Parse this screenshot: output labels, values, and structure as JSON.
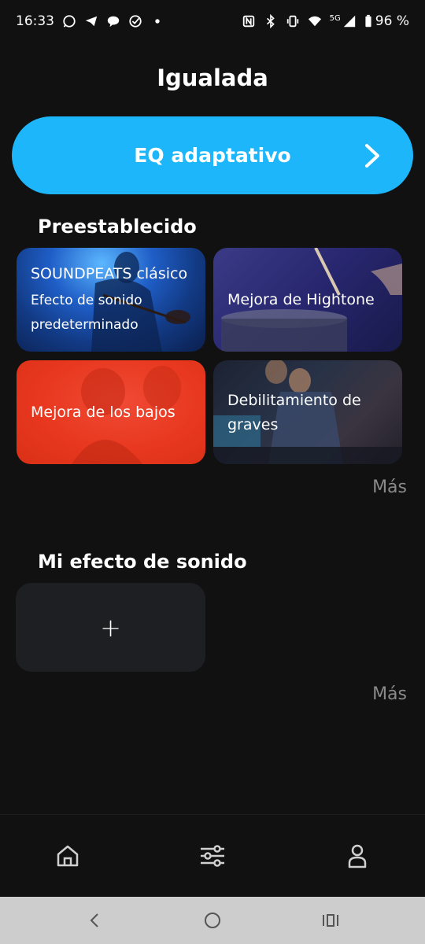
{
  "status_bar": {
    "time": "16:33",
    "battery": "96 %",
    "network": "5G",
    "left_icons": [
      "whatsapp-icon",
      "telegram-icon",
      "chat-bubble-icon",
      "check-circle-icon",
      "dot-icon"
    ],
    "right_icons": [
      "nfc-icon",
      "bluetooth-icon",
      "vibrate-icon",
      "wifi-icon",
      "signal-icon",
      "battery-icon"
    ]
  },
  "header": {
    "title": "Igualada"
  },
  "eq_adaptive": {
    "label": "EQ adaptativo",
    "accent": "#1eb6fa"
  },
  "presets": {
    "title": "Preestablecido",
    "cards": [
      {
        "title": "SOUNDPEATS clásico",
        "subtitle": "Efecto de sonido predeterminado"
      },
      {
        "title": "Mejora de Hightone"
      },
      {
        "title": "Mejora de los bajos",
        "color": "#e8381f"
      },
      {
        "title": "Debilitamiento de graves"
      }
    ],
    "more": "Más"
  },
  "my_effects": {
    "title": "Mi efecto de sonido",
    "add_label": "+",
    "more": "Más"
  },
  "tab_bar": {
    "items": [
      "home-icon",
      "equalizer-icon",
      "profile-icon"
    ]
  },
  "nav_bar": {
    "items": [
      "back-icon",
      "home-circle-icon",
      "recents-icon"
    ]
  }
}
